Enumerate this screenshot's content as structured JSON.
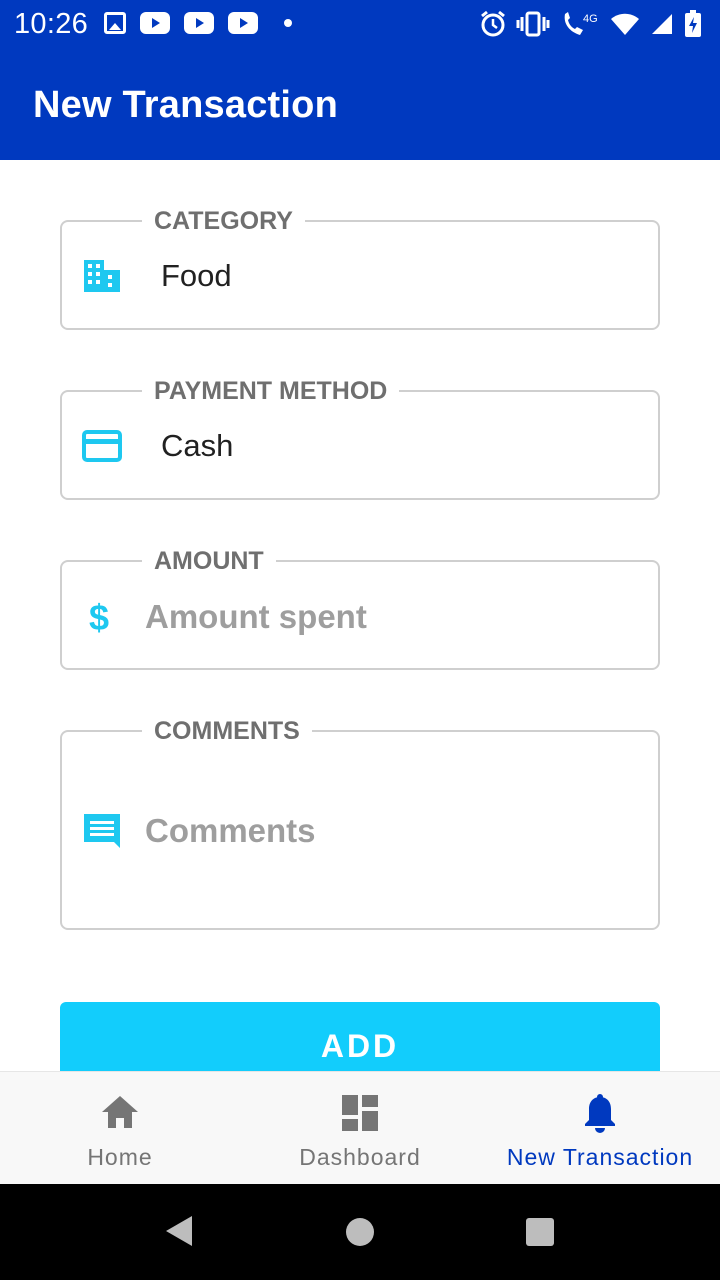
{
  "status_bar": {
    "time": "10:26",
    "network_label": "4G",
    "left_icons": [
      "image-icon",
      "youtube-icon",
      "youtube-icon",
      "youtube-icon",
      "dot-icon"
    ],
    "right_icons": [
      "alarm-icon",
      "vibrate-icon",
      "call-icon",
      "wifi-icon",
      "signal-icon",
      "battery-icon"
    ]
  },
  "app_bar": {
    "title": "New Transaction"
  },
  "form": {
    "category": {
      "label": "CATEGORY",
      "value": "Food",
      "icon": "building-icon"
    },
    "payment_method": {
      "label": "PAYMENT METHOD",
      "value": "Cash",
      "icon": "credit-card-icon"
    },
    "amount": {
      "label": "AMOUNT",
      "placeholder": "Amount spent",
      "icon": "dollar-icon"
    },
    "comments": {
      "label": "COMMENTS",
      "placeholder": "Comments",
      "icon": "comment-icon"
    }
  },
  "add_button": {
    "label": "ADD"
  },
  "bottom_nav": {
    "items": [
      {
        "label": "Home",
        "icon": "home-icon",
        "active": false
      },
      {
        "label": "Dashboard",
        "icon": "dashboard-icon",
        "active": false
      },
      {
        "label": "New Transaction",
        "icon": "bell-icon",
        "active": true
      }
    ]
  },
  "system_nav": {
    "buttons": [
      "back-icon",
      "home-circle-icon",
      "recents-icon"
    ]
  },
  "colors": {
    "primary": "#0039bf",
    "accent": "#12cdfc",
    "icon_tint": "#1ec8f0",
    "label_gray": "#6f6f6f",
    "placeholder_gray": "#9e9e9e",
    "border": "#cfcfcf"
  }
}
